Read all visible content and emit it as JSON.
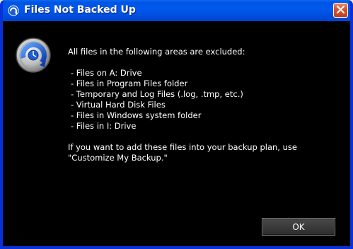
{
  "window": {
    "title": "Files Not Backed Up",
    "close_icon": "close-icon",
    "app_icon": "backup-globe-icon"
  },
  "message": {
    "intro": "All files in the following areas are excluded:",
    "items": [
      {
        "label": "- Files on A: Drive"
      },
      {
        "label": "- Files in Program Files folder"
      },
      {
        "label": "- Temporary and Log Files (.log, .tmp, etc.)"
      },
      {
        "label": "- Virtual Hard Disk Files"
      },
      {
        "label": "- Files in Windows system folder"
      },
      {
        "label": "- Files in I: Drive"
      }
    ],
    "outro_line1": "If you want to add these files into your backup plan, use",
    "outro_line2": "\"Customize My Backup.\""
  },
  "buttons": {
    "ok_label": "OK"
  },
  "colors": {
    "titlebar": "#0054e3",
    "background": "#000000",
    "text": "#ffffff",
    "close": "#d5532f"
  }
}
